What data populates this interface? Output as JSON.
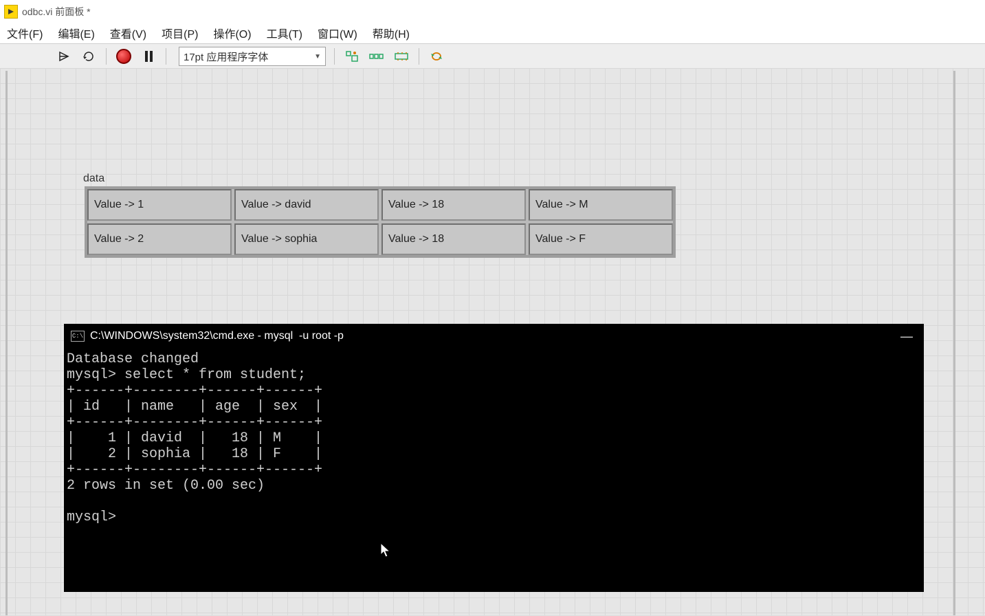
{
  "titlebar": {
    "title": "odbc.vi 前面板 *"
  },
  "menubar": {
    "items": [
      {
        "label": "文件(F)"
      },
      {
        "label": "编辑(E)"
      },
      {
        "label": "查看(V)"
      },
      {
        "label": "项目(P)"
      },
      {
        "label": "操作(O)"
      },
      {
        "label": "工具(T)"
      },
      {
        "label": "窗口(W)"
      },
      {
        "label": "帮助(H)"
      }
    ]
  },
  "toolbar": {
    "font_selector": "17pt 应用程序字体"
  },
  "data_indicator": {
    "label": "data",
    "rows": [
      {
        "c0": "Value -> 1",
        "c1": "Value -> david",
        "c2": "Value -> 18",
        "c3": "Value -> M"
      },
      {
        "c0": "Value -> 2",
        "c1": "Value -> sophia",
        "c2": "Value -> 18",
        "c3": "Value -> F"
      }
    ]
  },
  "cmd": {
    "title": "C:\\WINDOWS\\system32\\cmd.exe - mysql  -u root -p",
    "lines": [
      "Database changed",
      "mysql> select * from student;",
      "+------+--------+------+------+",
      "| id   | name   | age  | sex  |",
      "+------+--------+------+------+",
      "|    1 | david  |   18 | M    |",
      "|    2 | sophia |   18 | F    |",
      "+------+--------+------+------+",
      "2 rows in set (0.00 sec)",
      "",
      "mysql>"
    ]
  }
}
